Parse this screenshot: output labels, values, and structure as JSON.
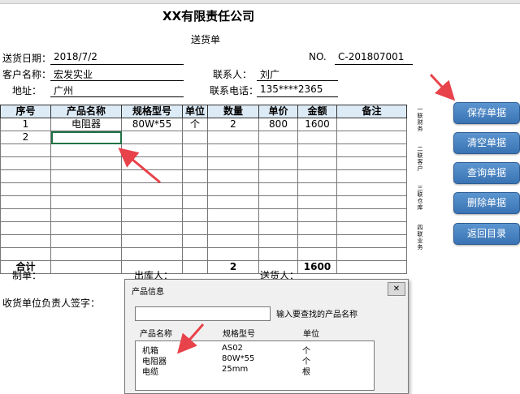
{
  "company_title": "XX有限责任公司",
  "doc_title": "送货单",
  "header": {
    "date_label": "送货日期：",
    "date_value": "2018/7/2",
    "no_label": "NO.",
    "no_value": "C-201807001",
    "customer_label": "客户名称：",
    "customer_value": "宏发实业",
    "contact_label": "联系人：",
    "contact_value": "刘广",
    "address_label": "地址：",
    "address_value": "广州",
    "phone_label": "联系电话：",
    "phone_value": "135****2365"
  },
  "table": {
    "columns": [
      "序号",
      "产品名称",
      "规格型号",
      "单位",
      "数量",
      "单价",
      "金额",
      "备注"
    ],
    "rows": [
      [
        "1",
        "电阻器",
        "80W*55",
        "个",
        "2",
        "800",
        "1600",
        ""
      ],
      [
        "2",
        "",
        "",
        "",
        "",
        "",
        "",
        ""
      ]
    ],
    "total_label": "合计",
    "total_qty": "2",
    "total_amount": "1600"
  },
  "side_labels": [
    "一联财务",
    "二联客户",
    "三联仓库",
    "四联业务"
  ],
  "footer": {
    "maker_label": "制单：",
    "warehouse_label": "出库人：",
    "deliverer_label": "送货人：",
    "receiver_label": "收货单位负责人签字："
  },
  "buttons": [
    "保存单据",
    "清空单据",
    "查询单据",
    "删除单据",
    "返回目录"
  ],
  "dialog": {
    "title": "产品信息",
    "close": "✕",
    "search_value": "",
    "search_hint": "输入要查找的产品名称",
    "headers": [
      "产品名称",
      "规格型号",
      "单位"
    ],
    "items": [
      [
        "机箱",
        "AS02",
        "个"
      ],
      [
        "电阻器",
        "80W*55",
        "个"
      ],
      [
        "电缆",
        "25mm",
        "根"
      ]
    ]
  },
  "colors": {
    "header_fill": "#ddebf7",
    "button": "#4a85c4",
    "arrow": "#e8424a",
    "selection": "#217346"
  }
}
